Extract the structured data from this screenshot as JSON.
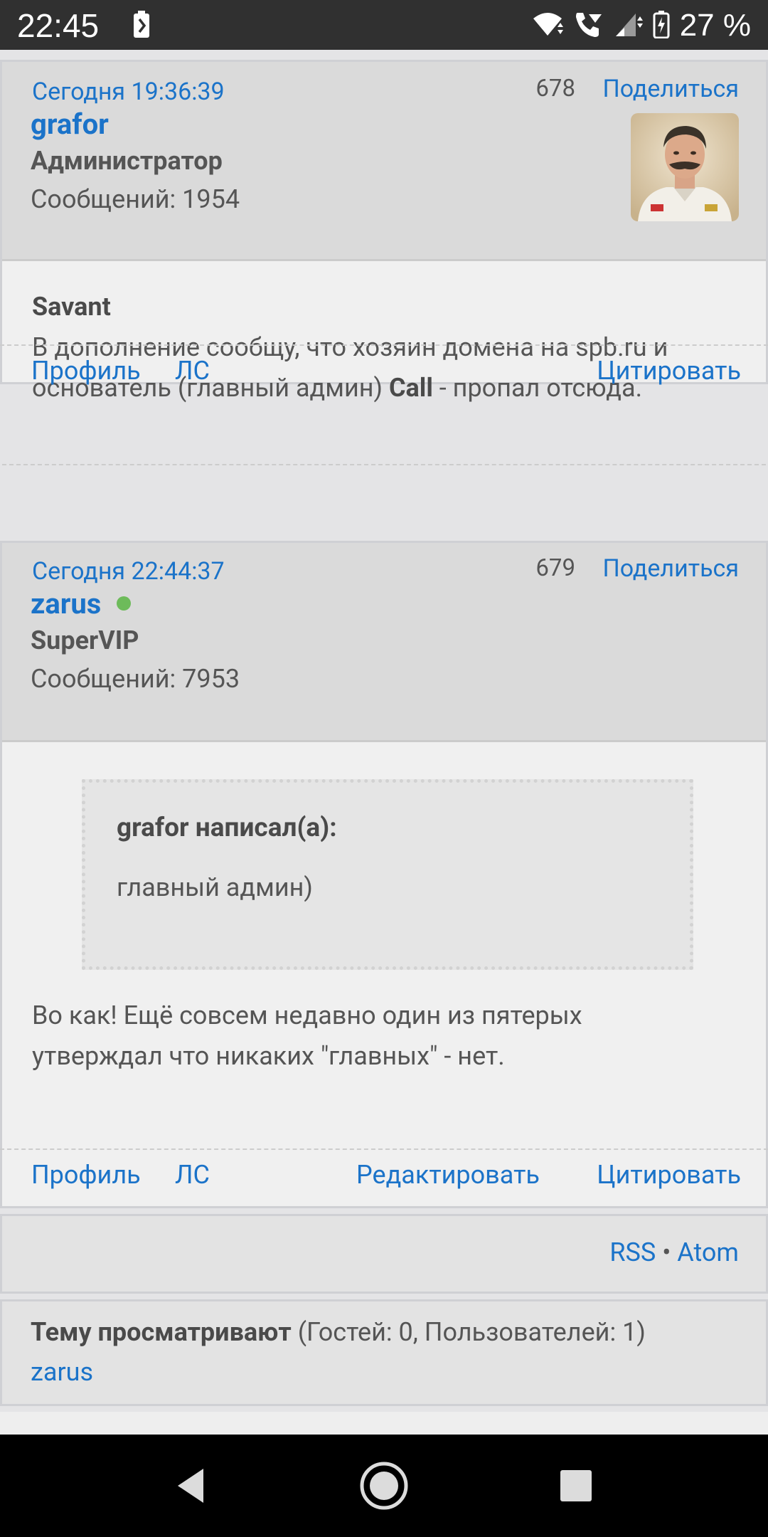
{
  "status_bar": {
    "time": "22:45",
    "battery_percent": "27 %"
  },
  "posts": [
    {
      "date": "Сегодня 19:36:39",
      "number": "678",
      "share_label": "Поделиться",
      "author": "grafor",
      "role": "Администратор",
      "messages": "Сообщений: 1954",
      "avatar_icon": "user-avatar-portrait",
      "body": {
        "addressee": "Savant",
        "text_before": "В дополнение сообщу, что хозяин домена на spb.ru и основатель (главный админ) ",
        "bold_word": "Call",
        "text_after": " - пропал отсюда."
      },
      "footer": {
        "profile": "Профиль",
        "pm": "ЛС",
        "quote": "Цитировать"
      }
    },
    {
      "date": "Сегодня 22:44:37",
      "number": "679",
      "share_label": "Поделиться",
      "author": "zarus",
      "online": true,
      "role": "SuperVIP",
      "messages": "Сообщений: 7953",
      "quote": {
        "title": "grafor написал(а):",
        "text": "главный админ)"
      },
      "body_text": "Во как! Ещё совсем недавно один из пятерых утверждал что никаких \"главных\" - нет.",
      "footer": {
        "profile": "Профиль",
        "pm": "ЛС",
        "edit": "Редактировать",
        "quote": "Цитировать"
      }
    }
  ],
  "feeds": {
    "rss": "RSS",
    "separator": "•",
    "atom": "Atom"
  },
  "viewers": {
    "label": "Тему просматривают",
    "counts": "(Гостей: 0, Пользователей: 1)",
    "users": [
      "zarus"
    ]
  },
  "colors": {
    "link": "#1b73c9",
    "header_bg": "#dadada",
    "post_bg": "#f0f0f0",
    "online": "#6dbb5a"
  }
}
